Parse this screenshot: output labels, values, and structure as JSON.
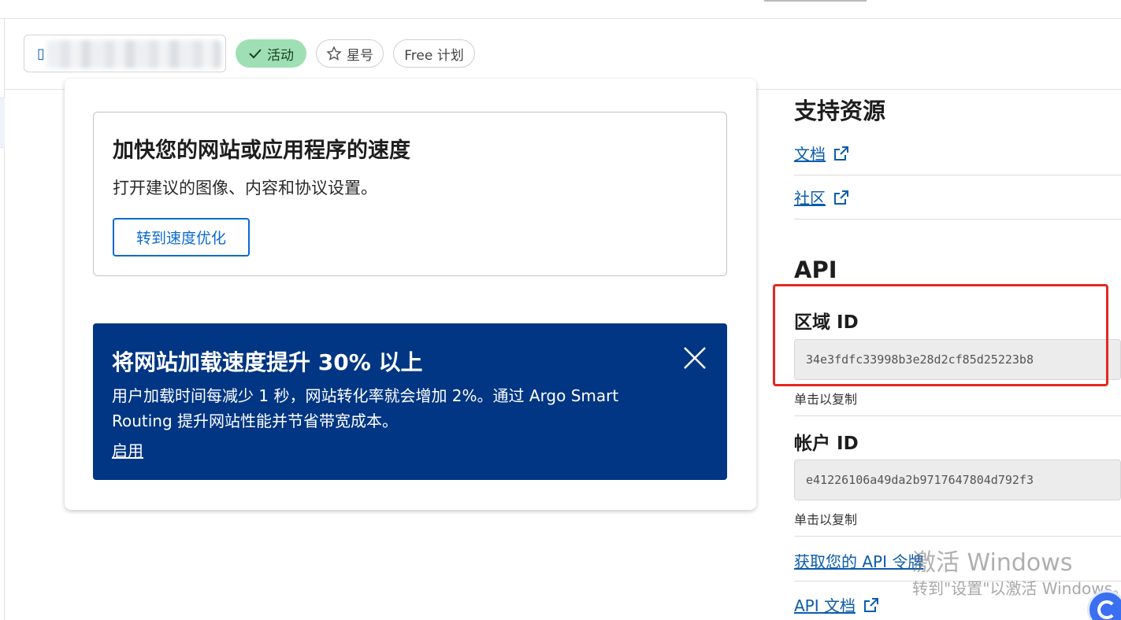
{
  "header": {
    "zone_selector_icon": "document-icon",
    "status_active": "活动",
    "star_label": "星号",
    "plan_label": "Free 计划"
  },
  "speed_card": {
    "title": "加快您的网站或应用程序的速度",
    "description": "打开建议的图像、内容和协议设置。",
    "button_label": "转到速度优化"
  },
  "argo_banner": {
    "title": "将网站加载速度提升 30% 以上",
    "description": "用户加载时间每减少 1 秒，网站转化率就会增加 2%。通过 Argo Smart Routing 提升网站性能并节省带宽成本。",
    "link_label": "启用",
    "background_color": "#003683"
  },
  "support": {
    "heading": "支持资源",
    "links": [
      {
        "label": "文档"
      },
      {
        "label": "社区"
      }
    ]
  },
  "api": {
    "heading": "API",
    "zone_id_label": "区域 ID",
    "zone_id_value": "34e3fdfc33998b3e28d2cf85d25223b8",
    "zone_copy_hint": "单击以复制",
    "account_id_label": "帐户 ID",
    "account_id_value": "e41226106a49da2b9717647804d792f3",
    "account_copy_hint": "单击以复制",
    "token_link": "获取您的 API 令牌",
    "docs_link": "API 文档"
  },
  "watermark": {
    "line1": "激活 Windows",
    "line2": "转到\"设置\"以激活 Windows。"
  },
  "colors": {
    "link": "#0b5cad",
    "active_pill": "#9ee0b4",
    "highlight": "#e5271f"
  }
}
